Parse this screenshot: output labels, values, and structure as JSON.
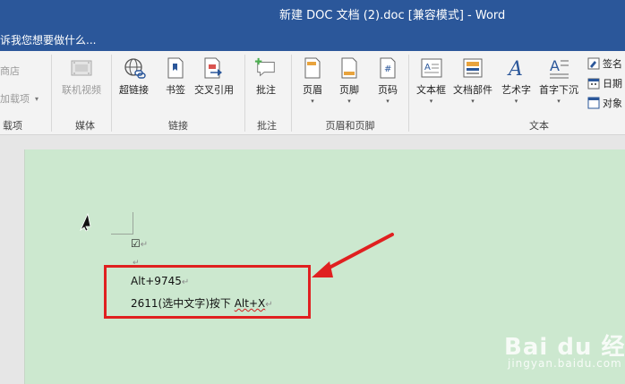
{
  "window": {
    "title": "新建 DOC 文档 (2).doc [兼容模式] - Word"
  },
  "tell_me": {
    "text": "诉我您想要做什么..."
  },
  "ribbon": {
    "items": {
      "store": "商店",
      "addins": "加载项",
      "online_video": "联机视频",
      "hyperlink": "超链接",
      "bookmark": "书签",
      "cross_reference": "交叉引用",
      "comment": "批注",
      "header": "页眉",
      "footer": "页脚",
      "page_number": "页码",
      "text_box": "文本框",
      "quick_parts": "文档部件",
      "wordart": "艺术字",
      "drop_cap": "首字下沉",
      "signature_line": "签名",
      "date_time": "日期",
      "object": "对象"
    },
    "groups": {
      "addins": "载项",
      "media": "媒体",
      "links": "链接",
      "comments": "批注",
      "header_footer": "页眉和页脚",
      "text": "文本"
    }
  },
  "document": {
    "check_symbol": "☑",
    "line1": "Alt+9745",
    "line2_prefix": "2611(选中文字)按下 ",
    "line2_key": "Alt+X",
    "para_mark": "↵"
  },
  "watermark": {
    "logo": "Bai du 经验",
    "url": "jingyan.baidu.com"
  },
  "colors": {
    "title_bar": "#2b579a",
    "page_background": "#cce8cf",
    "highlight_box": "#e02020",
    "arrow": "#e02020"
  }
}
